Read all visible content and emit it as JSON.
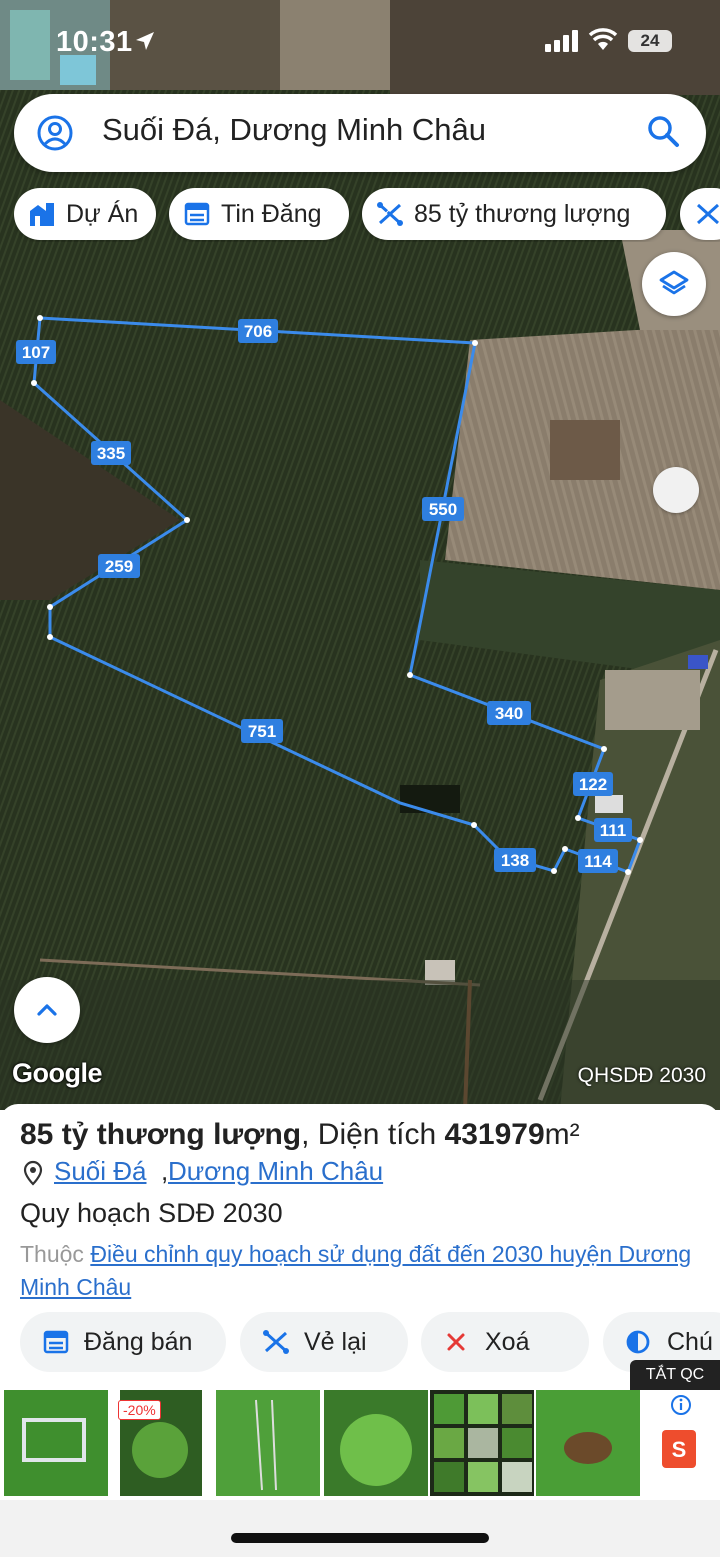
{
  "status_bar": {
    "time": "10:31",
    "battery": "24"
  },
  "search": {
    "query": "Suối Đá, Dương Minh Châu",
    "icon_left": "user-circle-icon",
    "icon_right": "search-icon"
  },
  "chips": [
    {
      "label": "Dự Án",
      "icon": "building-icon"
    },
    {
      "label": "Tin Đăng",
      "icon": "calendar-list-icon"
    },
    {
      "label": "85 tỷ thương lượng",
      "icon": "polygon-draw-icon"
    }
  ],
  "map": {
    "attribution": "Google",
    "layer_tag": "QHSDĐ 2030",
    "boundary_color": "#3b8beb",
    "edge_labels": [
      "706",
      "107",
      "335",
      "550",
      "259",
      "751",
      "340",
      "122",
      "111",
      "138",
      "114"
    ]
  },
  "listing": {
    "price": "85 tỷ thương lượng",
    "area_label": "Diện tích",
    "area_value": "431979",
    "area_unit": "m²",
    "location_commune": "Suối Đá",
    "location_district": "Dương Minh Châu",
    "plan_title": "Quy hoạch SDĐ 2030",
    "belongs_prefix": "Thuộc",
    "belongs_link": "Điều chỉnh quy hoạch sử dụng đất đến 2030 huyện Dương Minh Châu"
  },
  "actions": [
    {
      "label": "Đăng bán",
      "icon": "calendar-list-icon"
    },
    {
      "label": "Vẻ lại",
      "icon": "polygon-draw-icon"
    },
    {
      "label": "Xoá",
      "icon": "close-icon"
    },
    {
      "label": "Chú",
      "icon": "contrast-icon"
    }
  ],
  "ad": {
    "close_label": "TẮT QC",
    "discount": "-20%",
    "shop_letter": "S"
  },
  "colors": {
    "accent": "#2a6fcc",
    "boundary": "#3b8beb",
    "label_bg": "#2f7fe0"
  }
}
